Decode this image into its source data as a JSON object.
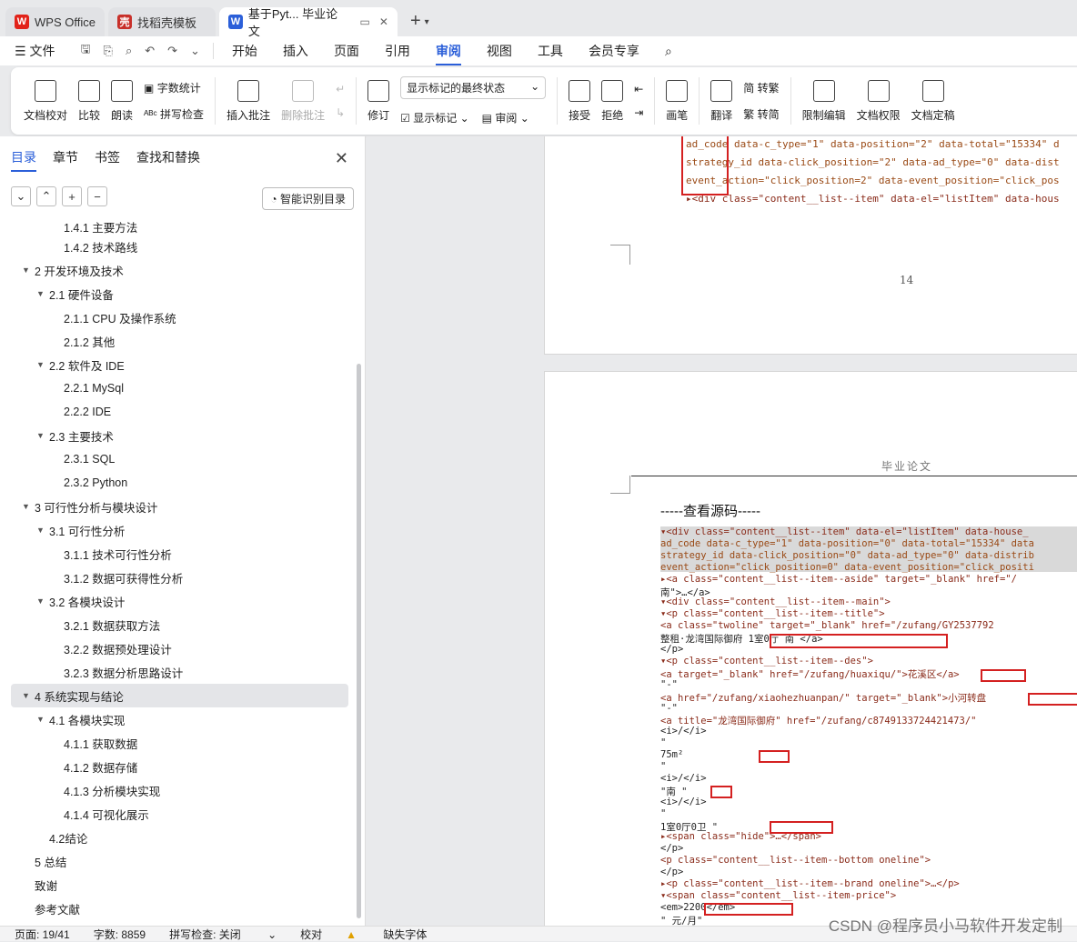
{
  "tabs": [
    {
      "label": "WPS Office"
    },
    {
      "label": "找稻壳模板"
    },
    {
      "label": "基于Pyt... 毕业论文"
    }
  ],
  "menu": {
    "file": "文件",
    "items": [
      "开始",
      "插入",
      "页面",
      "引用",
      "审阅",
      "视图",
      "工具",
      "会员专享"
    ]
  },
  "ribbon": {
    "doc_check": "文档校对",
    "compare": "比较",
    "read_aloud": "朗读",
    "word_count": "字数统计",
    "spell_check": "拼写检查",
    "insert_comment": "插入批注",
    "delete_comment": "删除批注",
    "revise": "修订",
    "markup_state": "显示标记的最终状态",
    "show_markup": "显示标记",
    "review": "审阅",
    "accept": "接受",
    "reject": "拒绝",
    "pen": "画笔",
    "translate": "翻译",
    "to_traditional": "简 转繁",
    "to_simplified": "繁 转简",
    "restrict_edit": "限制编辑",
    "doc_permission": "文档权限",
    "doc_finalize": "文档定稿"
  },
  "nav": {
    "tabs": [
      "目录",
      "章节",
      "书签",
      "查找和替换"
    ],
    "smart_btn": "智能识别目录",
    "toc": [
      {
        "label": "1.4.1 主要方法",
        "level": 3
      },
      {
        "label": "1.4.2 技术路线",
        "level": 3
      },
      {
        "label": "2 开发环境及技术",
        "level": 1
      },
      {
        "label": "2.1 硬件设备",
        "level": 2
      },
      {
        "label": "2.1.1 CPU 及操作系统",
        "level": 3
      },
      {
        "label": "2.1.2 其他",
        "level": 3
      },
      {
        "label": "2.2 软件及 IDE",
        "level": 2
      },
      {
        "label": "2.2.1 MySql",
        "level": 3
      },
      {
        "label": "2.2.2 IDE",
        "level": 3
      },
      {
        "label": "2.3 主要技术",
        "level": 2
      },
      {
        "label": "2.3.1 SQL",
        "level": 3
      },
      {
        "label": "2.3.2 Python",
        "level": 3
      },
      {
        "label": "3 可行性分析与模块设计",
        "level": 1
      },
      {
        "label": "3.1 可行性分析",
        "level": 2
      },
      {
        "label": "3.1.1 技术可行性分析",
        "level": 3
      },
      {
        "label": "3.1.2 数据可获得性分析",
        "level": 3
      },
      {
        "label": "3.2 各模块设计",
        "level": 2
      },
      {
        "label": "3.2.1 数据获取方法",
        "level": 3
      },
      {
        "label": "3.2.2 数据预处理设计",
        "level": 3
      },
      {
        "label": "3.2.3 数据分析思路设计",
        "level": 3
      },
      {
        "label": "4 系统实现与结论",
        "level": 1,
        "selected": true
      },
      {
        "label": "4.1 各模块实现",
        "level": 2
      },
      {
        "label": "4.1.1 获取数据",
        "level": 3
      },
      {
        "label": "4.1.2 数据存储",
        "level": 3
      },
      {
        "label": "4.1.3 分析模块实现",
        "level": 3
      },
      {
        "label": "4.1.4 可视化展示",
        "level": 3
      },
      {
        "label": "4.2结论",
        "level": 2
      },
      {
        "label": "5 总结",
        "level": 1
      },
      {
        "label": "致谢",
        "level": 1
      },
      {
        "label": "参考文献",
        "level": 1
      }
    ]
  },
  "doc": {
    "page1_lines": [
      "ad_code data-c_type=\"1\" data-position=\"2\" data-total=\"15334\" d",
      "strategy_id data-click_position=\"2\" data-ad_type=\"0\" data-dist",
      "event_action=\"click_position=2\" data-event_position=\"click_pos",
      "▸<div class=\"content__list--item\" data-el=\"listItem\" data-hous"
    ],
    "page1_number": "14",
    "page2_header": "毕业论文",
    "source_title": "-----查看源码-----",
    "code_lines": [
      "▾<div class=\"content__list--item\" data-el=\"listItem\" data-house_",
      "ad_code data-c_type=\"1\" data-position=\"0\" data-total=\"15334\" data",
      "strategy_id data-click_position=\"0\" data-ad_type=\"0\" data-distrib",
      "event_action=\"click_position=0\" data-event_position=\"click_positi",
      "  ▸<a class=\"content__list--item--aside\" target=\"_blank\" href=\"/",
      "南\">…</a>",
      "  ▾<div class=\"content__list--item--main\">",
      "    ▾<p class=\"content__list--item--title\">",
      "       <a class=\"twoline\" target=\"_blank\" href=\"/zufang/GY2537792",
      "             整租·龙湾国际御府 1室0厅 南            </a>",
      "     </p>",
      "    ▾<p class=\"content__list--item--des\">",
      "       <a target=\"_blank\" href=\"/zufang/huaxiqu/\">花溪区</a>",
      "       \"-\"",
      "       <a href=\"/zufang/xiaohezhuanpan/\" target=\"_blank\">小河转盘",
      "       \"-\"",
      "       <a title=\"龙湾国际御府\" href=\"/zufang/c8749133724421473/\"",
      "       <i>/</i>",
      "       \"",
      "            75m²",
      "            \"",
      "       <i>/</i>",
      "       \"南           \"",
      "       <i>/</i>",
      "       \"",
      "             1室0厅0卫           \"",
      "     ▸<span class=\"hide\">…</span>",
      "     </p>",
      "     <p class=\"content__list--item--bottom oneline\">",
      "             </p>",
      "    ▸<p class=\"content__list--item--brand oneline\">…</p>",
      "   ▾<span class=\"content__list--item-price\">",
      "      <em>2200</em>",
      "      \" 元/月\""
    ]
  },
  "status": {
    "page": "页面: 19/41",
    "words": "字数: 8859",
    "spell": "拼写检查: 关闭",
    "proof": "校对",
    "font_missing": "缺失字体"
  },
  "watermark": "CSDN @程序员小马软件开发定制"
}
